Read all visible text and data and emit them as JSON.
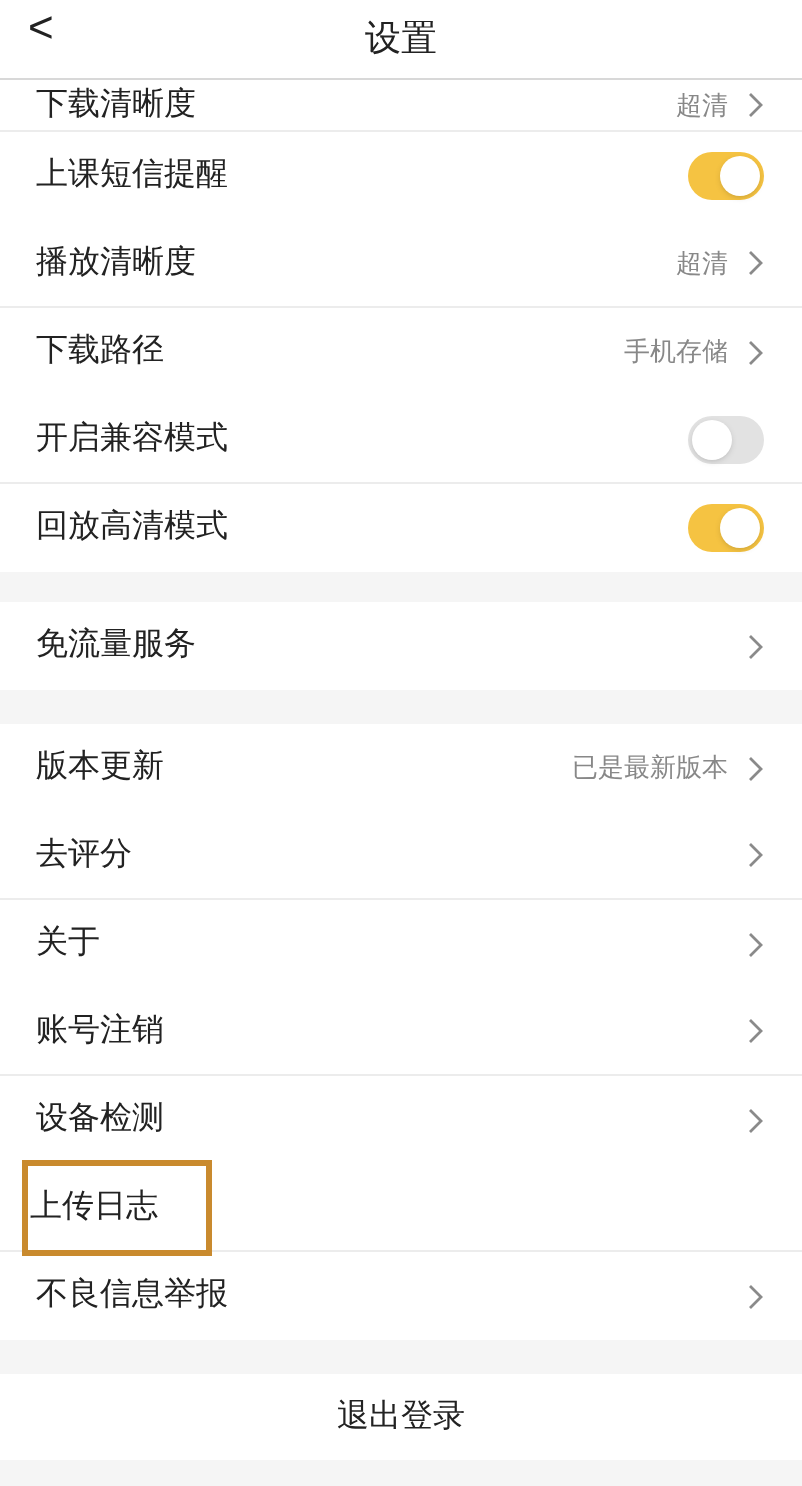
{
  "header": {
    "back": "<",
    "title": "设置"
  },
  "groups": [
    {
      "items": [
        {
          "kind": "link",
          "label": "下载清晰度",
          "value": "超清",
          "divider": true,
          "highlighted": false,
          "cut": true
        },
        {
          "kind": "toggle",
          "label": "上课短信提醒",
          "on": true,
          "divider": false,
          "highlighted": false
        },
        {
          "kind": "link",
          "label": "播放清晰度",
          "value": "超清",
          "divider": true,
          "highlighted": false
        },
        {
          "kind": "link",
          "label": "下载路径",
          "value": "手机存储",
          "divider": false,
          "highlighted": false
        },
        {
          "kind": "toggle",
          "label": "开启兼容模式",
          "on": false,
          "divider": true,
          "highlighted": false
        },
        {
          "kind": "toggle",
          "label": "回放高清模式",
          "on": true,
          "divider": false,
          "highlighted": false
        }
      ]
    },
    {
      "items": [
        {
          "kind": "link",
          "label": "免流量服务",
          "divider": false,
          "highlighted": false
        }
      ]
    },
    {
      "items": [
        {
          "kind": "link",
          "label": "版本更新",
          "value": "已是最新版本",
          "divider": false,
          "highlighted": false
        },
        {
          "kind": "link",
          "label": "去评分",
          "divider": true,
          "highlighted": false
        },
        {
          "kind": "link",
          "label": "关于",
          "divider": false,
          "highlighted": false
        },
        {
          "kind": "link",
          "label": "账号注销",
          "divider": true,
          "highlighted": false
        },
        {
          "kind": "link",
          "label": "设备检测",
          "divider": false,
          "highlighted": false
        },
        {
          "kind": "plain",
          "label": "上传日志",
          "divider": true,
          "highlighted": true
        },
        {
          "kind": "link",
          "label": "不良信息举报",
          "divider": false,
          "highlighted": false
        }
      ]
    }
  ],
  "logout": "退出登录"
}
